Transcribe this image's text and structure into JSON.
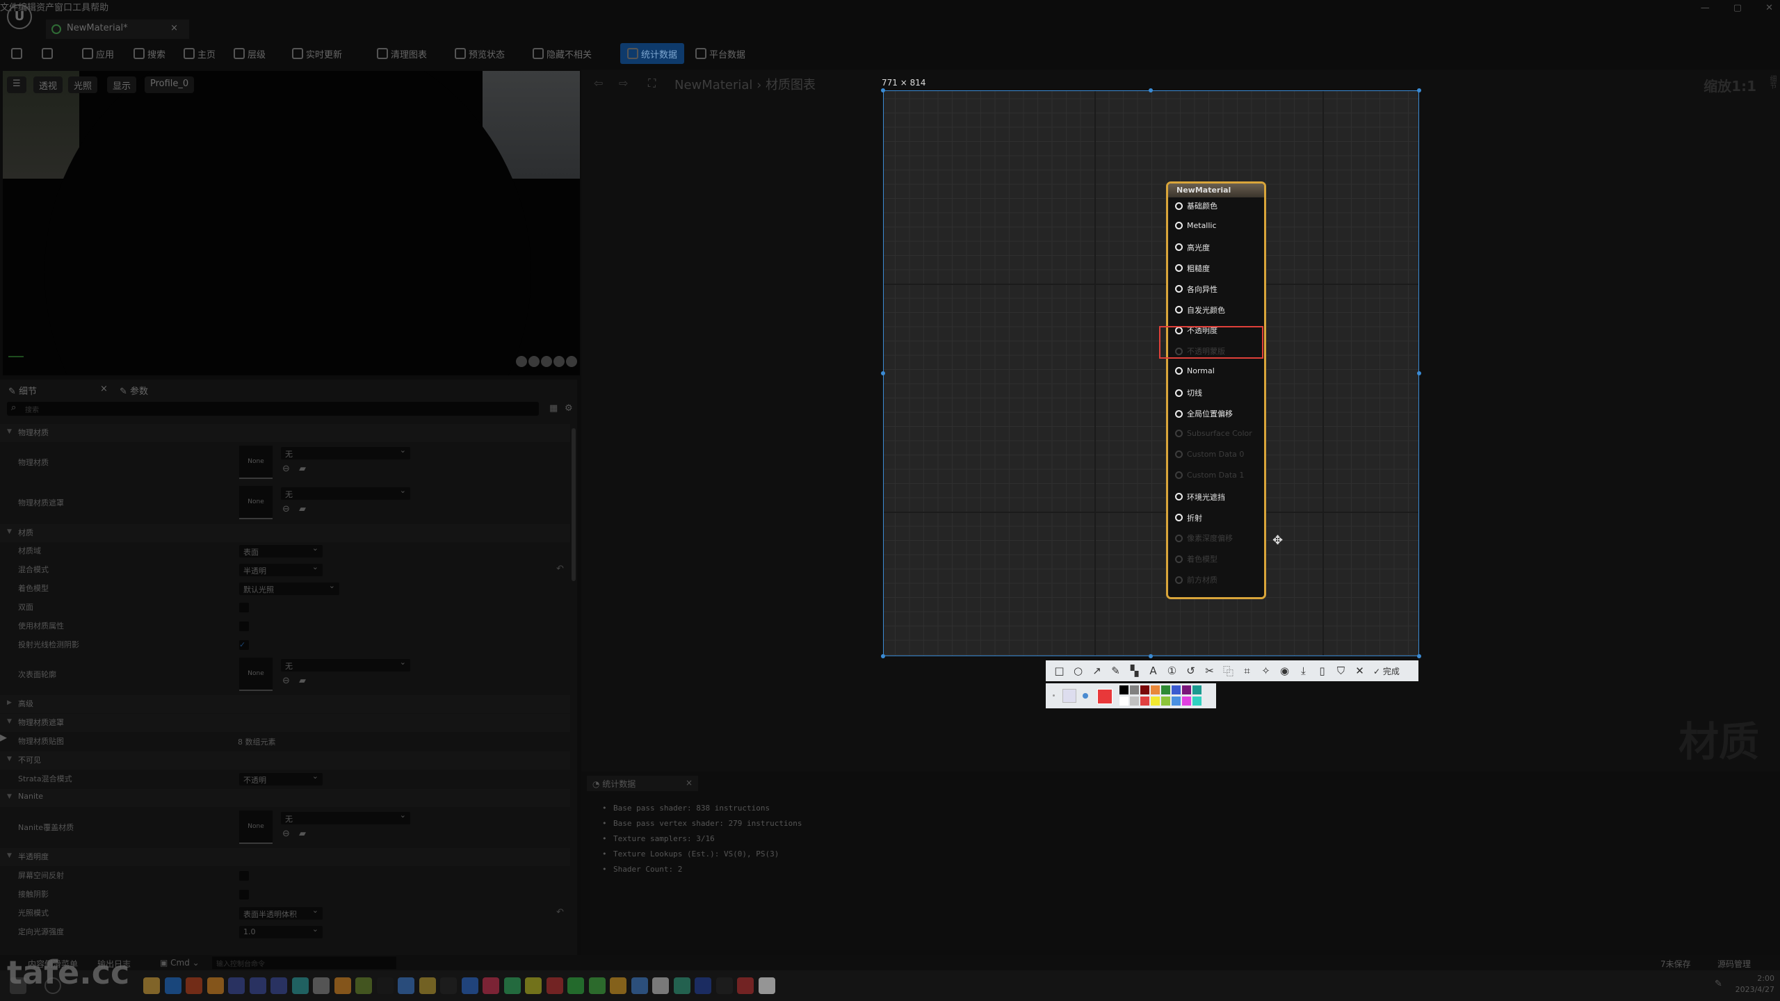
{
  "menu": [
    "文件",
    "编辑",
    "资产",
    "窗口",
    "工具",
    "帮助"
  ],
  "tab": {
    "title": "NewMaterial*",
    "close": "×"
  },
  "window_controls": [
    "—",
    "▢",
    "✕"
  ],
  "toolbar": [
    "应用",
    "搜索",
    "主页",
    "层级",
    "实时更新",
    "清理图表",
    "预览状态",
    "隐藏不相关",
    "统计数据",
    "平台数据"
  ],
  "toolbar_active": "统计数据",
  "viewport": {
    "buttons": [
      "☰",
      "透视",
      "光照",
      "显示",
      "Profile_0"
    ]
  },
  "details": {
    "tabs": [
      "细节",
      "参数"
    ],
    "close": "×",
    "search_placeholder": "搜索",
    "rows": [
      {
        "type": "cat",
        "label": "物理材质",
        "open": true
      },
      {
        "type": "asset",
        "label": "物理材质",
        "thumb": "None",
        "value": "无"
      },
      {
        "type": "asset",
        "label": "物理材质遮罩",
        "thumb": "None",
        "value": "无"
      },
      {
        "type": "cat",
        "label": "材质",
        "open": true
      },
      {
        "type": "dropdown",
        "label": "材质域",
        "value": "表面"
      },
      {
        "type": "dropdown",
        "label": "混合模式",
        "value": "半透明",
        "reset": true
      },
      {
        "type": "dropdown",
        "label": "着色模型",
        "value": "默认光照"
      },
      {
        "type": "check",
        "label": "双面",
        "checked": false
      },
      {
        "type": "check",
        "label": "使用材质属性",
        "checked": false
      },
      {
        "type": "check",
        "label": "投射光线检测阴影",
        "checked": true
      },
      {
        "type": "asset",
        "label": "次表面轮廓",
        "thumb": "None",
        "value": "无"
      },
      {
        "type": "cat",
        "label": "高级",
        "open": false
      },
      {
        "type": "cat",
        "label": "物理材质遮罩",
        "open": true
      },
      {
        "type": "text",
        "label": "物理材质贴图",
        "value": "8 数组元素",
        "collapsed": true
      },
      {
        "type": "cat",
        "label": "不可见",
        "open": true
      },
      {
        "type": "dropdown",
        "label": "Strata混合模式",
        "value": "不透明"
      },
      {
        "type": "cat",
        "label": "Nanite",
        "open": true
      },
      {
        "type": "asset",
        "label": "Nanite覆盖材质",
        "thumb": "None",
        "value": "无"
      },
      {
        "type": "cat",
        "label": "半透明度",
        "open": true
      },
      {
        "type": "check",
        "label": "屏幕空间反射",
        "checked": false
      },
      {
        "type": "check",
        "label": "接触阴影",
        "checked": false
      },
      {
        "type": "dropdown",
        "label": "光照模式",
        "value": "表面半透明体积",
        "reset": true
      },
      {
        "type": "input",
        "label": "定向光源强度",
        "value": "1.0"
      }
    ]
  },
  "graph": {
    "breadcrumb": [
      "NewMaterial",
      "材质图表"
    ],
    "zoom": "缩放1:1",
    "side_label": "细节",
    "watermark": "材质",
    "selection_size": "771 × 814"
  },
  "node": {
    "title": "NewMaterial",
    "pins": [
      {
        "label": "基础颜色",
        "enabled": true
      },
      {
        "label": "Metallic",
        "enabled": true
      },
      {
        "label": "高光度",
        "enabled": true
      },
      {
        "label": "粗糙度",
        "enabled": true
      },
      {
        "label": "各向异性",
        "enabled": true
      },
      {
        "label": "自发光颜色",
        "enabled": true
      },
      {
        "label": "不透明度",
        "enabled": true
      },
      {
        "label": "不透明蒙版",
        "enabled": false
      },
      {
        "label": "Normal",
        "enabled": true
      },
      {
        "label": "切线",
        "enabled": true
      },
      {
        "label": "全局位置偏移",
        "enabled": true
      },
      {
        "label": "Subsurface Color",
        "enabled": false
      },
      {
        "label": "Custom Data 0",
        "enabled": false
      },
      {
        "label": "Custom Data 1",
        "enabled": false
      },
      {
        "label": "环境光遮挡",
        "enabled": true
      },
      {
        "label": "折射",
        "enabled": true
      },
      {
        "label": "像素深度偏移",
        "enabled": false
      },
      {
        "label": "着色模型",
        "enabled": false
      },
      {
        "label": "前方材质",
        "enabled": false
      }
    ],
    "highlight_color": "#e0403a",
    "border_color": "#d9a53a"
  },
  "snip_toolbar": {
    "tools": [
      "rectangle-icon",
      "ellipse-icon",
      "arrow-icon",
      "pencil-icon",
      "mosaic-icon",
      "text-icon",
      "number-icon",
      "undo-icon",
      "cut-icon",
      "translate-icon",
      "ocr-icon",
      "pin-icon",
      "record-icon",
      "download-icon",
      "phone-icon",
      "bookmark-icon",
      "close-icon"
    ],
    "glyphs": [
      "□",
      "○",
      "↗",
      "✎",
      "▚",
      "A",
      "①",
      "↺",
      "✂",
      "⿻",
      "⌗",
      "✧",
      "◉",
      "⤓",
      "▯",
      "⛉",
      "✕"
    ],
    "done": "✓ 完成",
    "current_color": "#e8383a",
    "palette": [
      "#000000",
      "#808080",
      "#7a0a0a",
      "#e8883a",
      "#2e8a35",
      "#3b5bd0",
      "#7a177a",
      "#1b9a90",
      "#ffffff",
      "#c0c0c0",
      "#e04040",
      "#f2e830",
      "#8cc43a",
      "#4a90e0",
      "#e040e0",
      "#30d0c0"
    ]
  },
  "stats": {
    "tab": "统计数据",
    "close": "×",
    "lines": [
      "Base pass shader: 838 instructions",
      "Base pass vertex shader: 279 instructions",
      "Texture samplers: 3/16",
      "Texture Lookups (Est.): VS(0), PS(3)",
      "Shader Count: 2"
    ]
  },
  "statusbar": {
    "left": [
      "内容侧滑菜单",
      "输出日志",
      "Cmd"
    ],
    "cmd_placeholder": "输入控制台命令",
    "right": [
      "7未保存",
      "源码管理"
    ]
  },
  "watermark_logo": "tafe.cc",
  "taskbar": {
    "icons": [
      "explorer",
      "photoshop",
      "illustrator",
      "blender",
      "cinema4d",
      "cinema4d",
      "cinema4d",
      "3dsmax",
      "zbrush",
      "marmoset",
      "daz",
      "substance",
      "davinci",
      "maya",
      "epic",
      "bluestacks",
      "mudbox",
      "app",
      "app",
      "qq",
      "wechat",
      "app",
      "chrome",
      "baidu",
      "app",
      "app",
      "app",
      "camera",
      "qq",
      "unreal"
    ],
    "colors": [
      "#d9a53a",
      "#1e6fd0",
      "#c0401a",
      "#e08a20",
      "#3a4aa0",
      "#3a4aa0",
      "#3a4aa0",
      "#2aa0a0",
      "#888888",
      "#e08a20",
      "#6a8a2a",
      "#1a1a1a",
      "#3a7ad0",
      "#c0a030",
      "#222222",
      "#2a6ad0",
      "#d03050",
      "#30b060",
      "#c0c020",
      "#c03030",
      "#30b040",
      "#40b040",
      "#e0a020",
      "#4080d0",
      "#cccccc",
      "#30a080",
      "#2040a0",
      "#222222",
      "#c03030",
      "#ffffff"
    ],
    "time": "2:00",
    "date": "2023/4/27"
  }
}
